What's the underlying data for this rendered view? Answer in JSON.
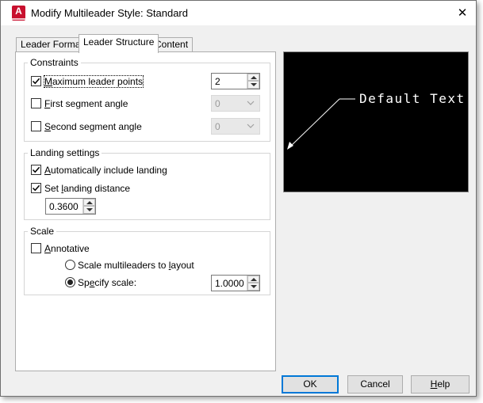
{
  "window": {
    "title": "Modify Multileader Style: Standard",
    "app_icon": "A",
    "close_glyph": "✕"
  },
  "tabs": [
    {
      "label": "Leader Format",
      "active": false
    },
    {
      "label": "Leader Structure",
      "active": true
    },
    {
      "label": "Content",
      "active": false
    }
  ],
  "constraints": {
    "title": "Constraints",
    "max_points": {
      "label_mnemonic": "M",
      "label_rest": "aximum leader points",
      "checked": true,
      "value": "2"
    },
    "first_angle": {
      "label_mnemonic": "F",
      "label_rest": "irst segment angle",
      "checked": false,
      "value": "0"
    },
    "second_angle": {
      "label_mnemonic": "S",
      "label_rest": "econd segment angle",
      "checked": false,
      "value": "0"
    }
  },
  "landing": {
    "title": "Landing settings",
    "auto_include": {
      "label_mnemonic": "A",
      "label_rest": "utomatically include landing",
      "checked": true
    },
    "set_distance": {
      "label_prefix": "Set ",
      "label_mnemonic": "l",
      "label_rest": "anding distance",
      "checked": true
    },
    "distance_value": "0.3600"
  },
  "scale": {
    "title": "Scale",
    "annotative": {
      "label_mnemonic": "A",
      "label_rest": "nnotative",
      "checked": false
    },
    "to_layout": {
      "label_prefix": "Scale multileaders to ",
      "label_mnemonic": "l",
      "label_rest": "ayout",
      "selected": false
    },
    "specify": {
      "label_prefix": "Sp",
      "label_mnemonic": "e",
      "label_rest": "cify scale:",
      "selected": true,
      "value": "1.0000"
    }
  },
  "preview": {
    "text": "Default Text"
  },
  "buttons": {
    "ok": "OK",
    "cancel": "Cancel",
    "help_mnemonic": "H",
    "help_rest": "elp"
  },
  "colors": {
    "accent": "#0078d7",
    "app_icon": "#c8102e",
    "preview_bg": "#000000"
  }
}
